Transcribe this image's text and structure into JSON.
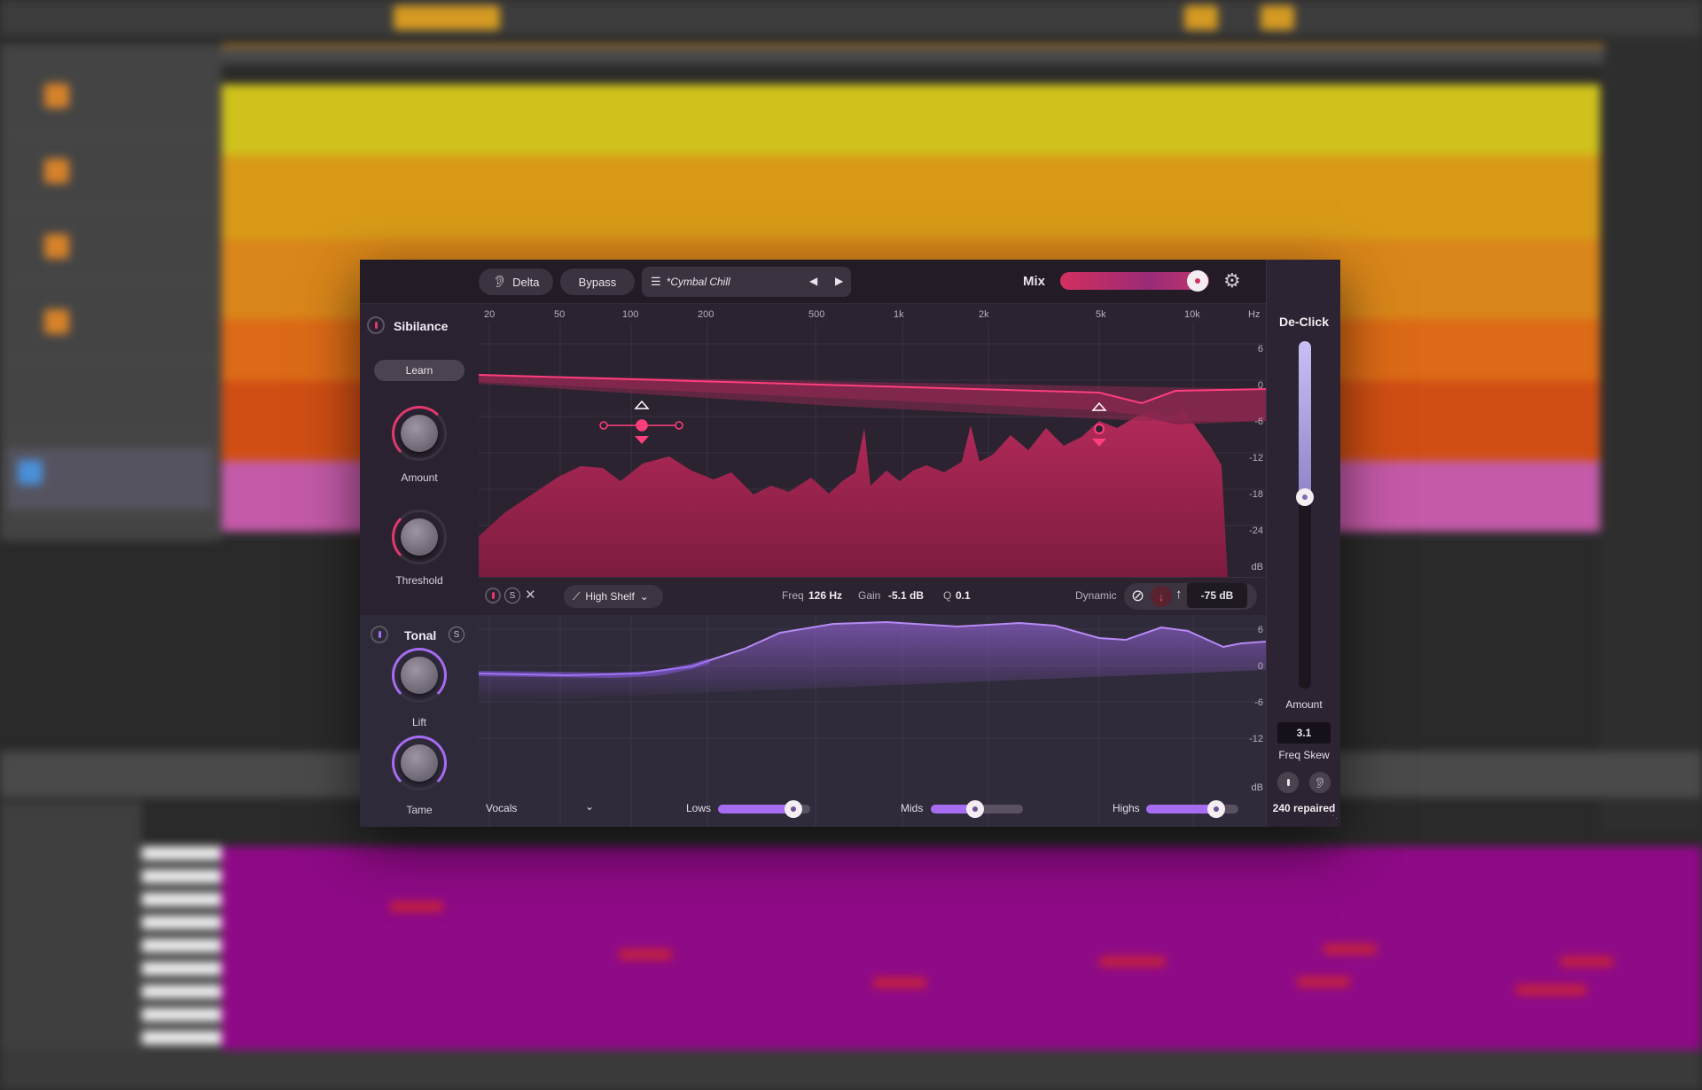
{
  "toolbar": {
    "delta_label": "Delta",
    "bypass_label": "Bypass",
    "preset_name": "*Cymbal Chill",
    "mix_label": "Mix",
    "mix_value": 0.92
  },
  "sibilance": {
    "title": "Sibilance",
    "learn_label": "Learn",
    "amount_label": "Amount",
    "threshold_label": "Threshold",
    "freq_ticks": [
      "20",
      "50",
      "100",
      "200",
      "500",
      "1k",
      "2k",
      "5k",
      "10k",
      "Hz"
    ],
    "db_ticks": [
      "6",
      "0",
      "-6",
      "-12",
      "-18",
      "-24",
      "dB"
    ],
    "band_type": "High Shelf",
    "freq_label": "Freq",
    "freq_value": "126 Hz",
    "gain_label": "Gain",
    "gain_value": "-5.1 dB",
    "q_label": "Q",
    "q_value": "0.1",
    "dynamic_label": "Dynamic",
    "threshold_value": "-75 dB"
  },
  "tonal": {
    "title": "Tonal",
    "lift_label": "Lift",
    "tame_label": "Tame",
    "db_ticks": [
      "6",
      "0",
      "-6",
      "-12",
      "dB"
    ],
    "profile": "Vocals",
    "lows_label": "Lows",
    "lows_value": 0.82,
    "mids_label": "Mids",
    "mids_value": 0.48,
    "highs_label": "Highs",
    "highs_value": 0.76
  },
  "declick": {
    "title": "De-Click",
    "amount_label": "Amount",
    "amount_value": 0.55,
    "freq_skew_value": "3.1",
    "freq_skew_label": "Freq Skew",
    "repaired_text": "240 repaired"
  },
  "colors": {
    "sibilance_accent": "#e3386e",
    "tonal_accent": "#a66cf2",
    "declick_accent": "#c9c0f5"
  }
}
